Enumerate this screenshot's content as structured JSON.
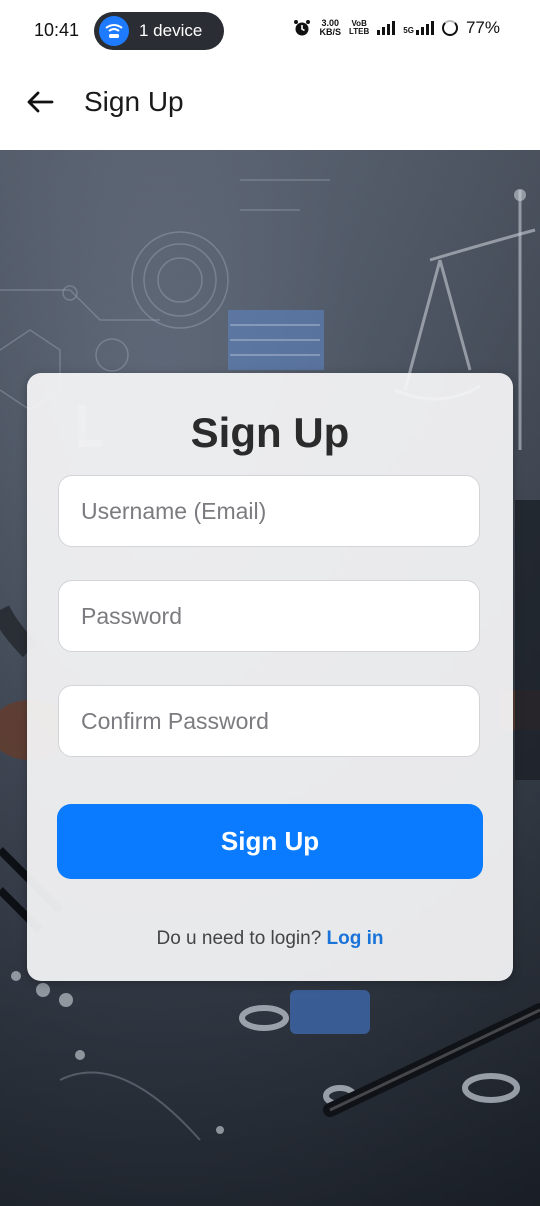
{
  "status_bar": {
    "time": "10:41",
    "device_pill": "1 device",
    "net_speed_top": "3.00",
    "net_speed_bottom": "KB/S",
    "vowifi_top": "VoB",
    "vowifi_bottom": "LTEB",
    "five_g": "5G",
    "battery": "77%"
  },
  "app_bar": {
    "title": "Sign Up"
  },
  "form": {
    "heading": "Sign Up",
    "username_placeholder": "Username (Email)",
    "password_placeholder": "Password",
    "confirm_placeholder": "Confirm Password",
    "submit_label": "Sign Up",
    "login_prompt": "Do u need to login?",
    "login_link": "Log in"
  },
  "colors": {
    "primary": "#0a7bff",
    "link": "#1a73d9",
    "wifi_badge": "#1e7bff"
  }
}
